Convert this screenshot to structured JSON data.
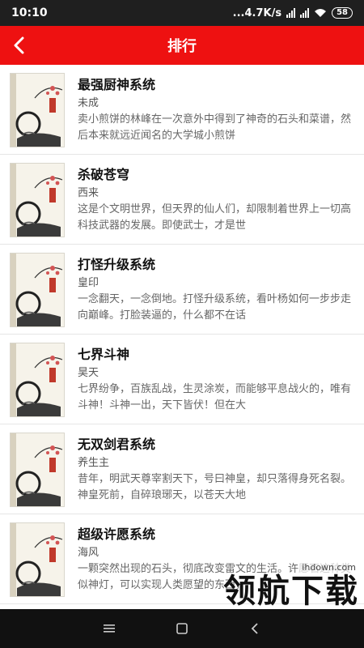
{
  "status_bar": {
    "time": "10:10",
    "network_speed": "...4.7K/s",
    "signal_labels": [
      "HD",
      "HD"
    ],
    "battery": "58"
  },
  "app_bar": {
    "title": "排行",
    "back_icon": "chevron-left-icon"
  },
  "books": [
    {
      "title": "最强厨神系统",
      "author": "未成",
      "description": "卖小煎饼的林峰在一次意外中得到了神奇的石头和菜谱，然后本来就远近闻名的大学城小煎饼"
    },
    {
      "title": "杀破苍穹",
      "author": "西来",
      "description": "这是个文明世界，但天界的仙人们，却限制着世界上一切高科技武器的发展。即使武士，才是世"
    },
    {
      "title": "打怪升级系统",
      "author": "皇印",
      "description": "一念翻天，一念倒地。打怪升级系统，看叶杨如何一步步走向巅峰。打脸装逼的，什么都不在话"
    },
    {
      "title": "七界斗神",
      "author": "昊天",
      "description": "七界纷争，百族乱战，生灵涂炭，而能够平息战火的，唯有斗神！斗神一出，天下皆伏！但在大"
    },
    {
      "title": "无双剑君系统",
      "author": "养生主",
      "description": "昔年，明武天尊宰割天下，号曰神皇，却只落得身死名裂。神皇死前，自碎琅琊天，以苍天大地"
    },
    {
      "title": "超级许愿系统",
      "author": "海风",
      "description": "一颗突然出现的石头，彻底改变雷文的生活。许愿石这种类似神灯，可以实现人类愿望的东西，"
    }
  ],
  "watermark": {
    "url": "ihdown.com",
    "text": "领航下载"
  },
  "nav_bar": {
    "icons": [
      "menu-icon",
      "home-icon",
      "back-icon"
    ]
  },
  "colors": {
    "accent": "#ee1111",
    "status_bar": "#1f1f1f",
    "nav_bar": "#111111"
  }
}
